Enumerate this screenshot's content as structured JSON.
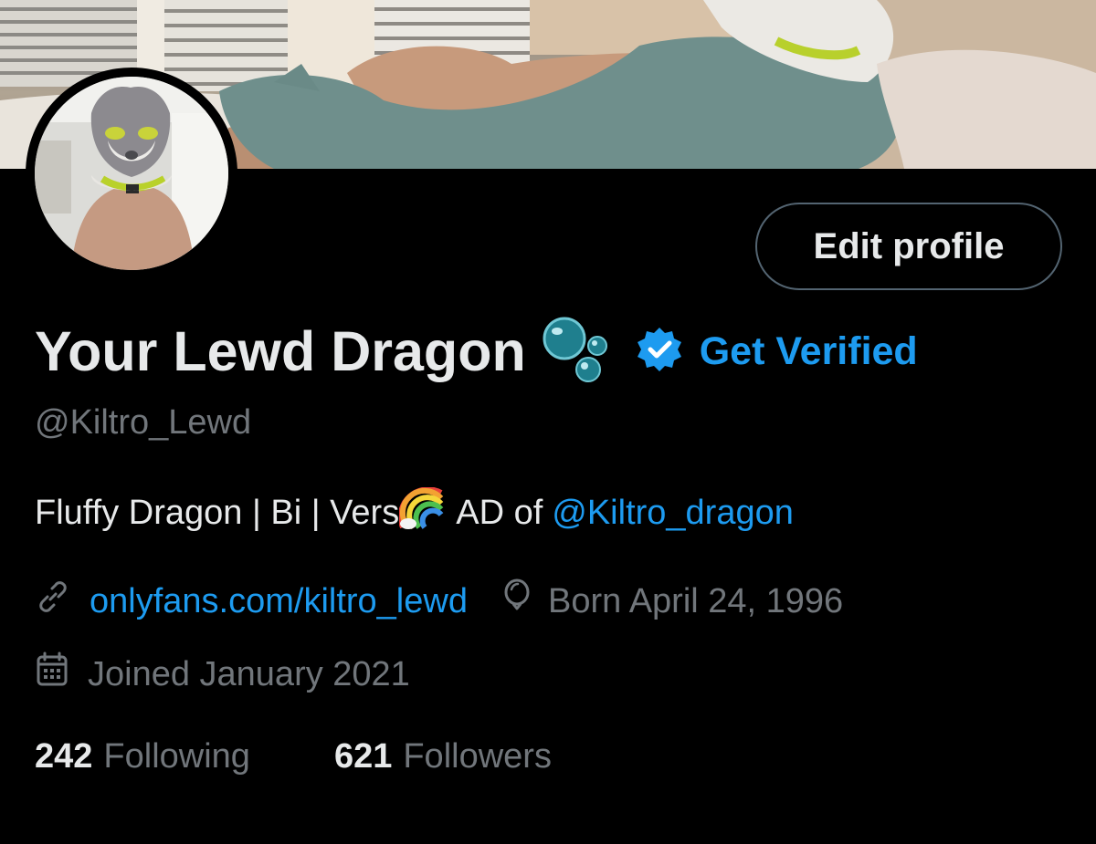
{
  "profile": {
    "display_name": "Your Lewd Dragon",
    "name_emoji": "bubbles-icon",
    "verify_cta": "Get Verified",
    "handle": "@Kiltro_Lewd",
    "edit_profile_label": "Edit profile"
  },
  "bio": {
    "text": "Fluffy Dragon | Bi | Vers",
    "emoji": "rainbow-icon",
    "after_emoji": "AD of",
    "mention": "@Kiltro_dragon"
  },
  "meta": {
    "website": "onlyfans.com/kiltro_lewd",
    "birthday": "Born April 24, 1996",
    "joined": "Joined January 2021"
  },
  "stats": {
    "following_count": "242",
    "following_label": "Following",
    "followers_count": "621",
    "followers_label": "Followers"
  },
  "colors": {
    "background": "#000000",
    "primary_text": "#e7e9ea",
    "secondary_text": "#71767b",
    "accent": "#1d9bf0",
    "button_border": "#536471"
  }
}
